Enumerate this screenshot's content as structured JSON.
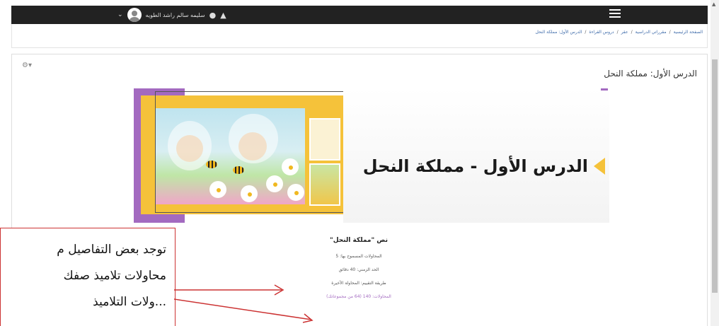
{
  "navbar": {
    "username": "سليمه سالم راشد الطويه",
    "bell_icon": "bell-icon",
    "chat_icon": "chat-icon",
    "menu_icon": "hamburger-menu-icon",
    "background": "#222222"
  },
  "breadcrumb": {
    "items": [
      "الصفحة الرئيسية",
      "مقرراتي الدراسية",
      "عقر",
      "دروس القراءة",
      "الدرس الأول: مملكة النحل"
    ]
  },
  "page": {
    "title": "الدرس الأول: مملكة النحل",
    "settings_icon": "gear-icon"
  },
  "banner": {
    "heading": "الدرس الأول - مملكة النحل",
    "accent_purple": "#a36ac0",
    "accent_yellow": "#f5c23a"
  },
  "quiz": {
    "title": "نص \"مملكة النحل\"",
    "attempts_allowed": "المحاولات المسموح بها: 5",
    "time_limit": "الحد الزمني: 40 دقائق",
    "grading_method": "طريقة التقييم: المحاولة الأخيرة",
    "attempts_link": "المحاولات: 140 (64 من مجموعاتك)"
  },
  "callout": {
    "line1": "توجد بعض التفاصيل م",
    "line2": "محاولات تلاميذ صفك",
    "line3": "...ولات التلاميذ",
    "border_color": "#cc3333"
  }
}
